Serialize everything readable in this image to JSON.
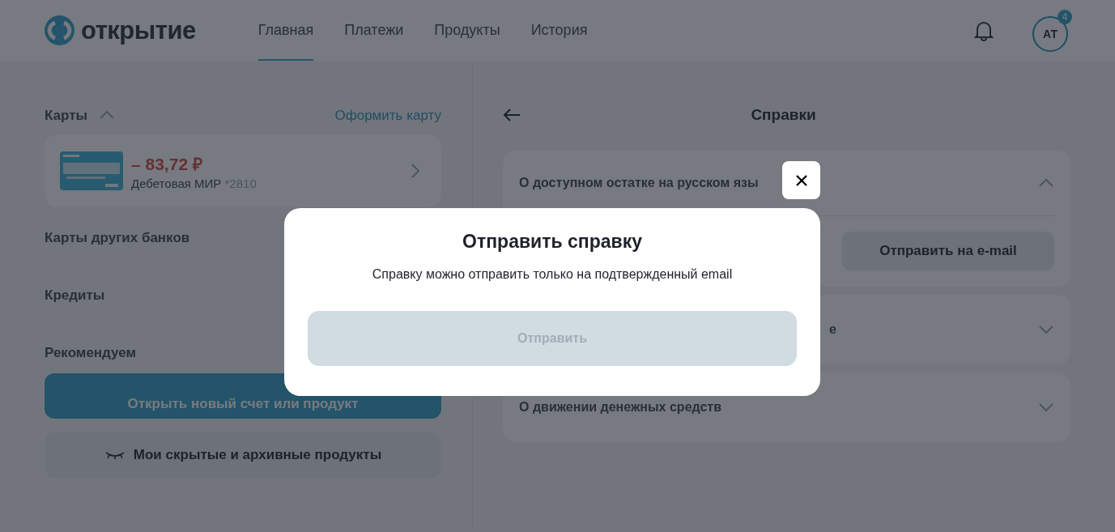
{
  "header": {
    "logo": "открытие",
    "nav": [
      {
        "label": "Главная",
        "selected": true
      },
      {
        "label": "Платежи",
        "selected": false
      },
      {
        "label": "Продукты",
        "selected": false
      },
      {
        "label": "История",
        "selected": false
      }
    ],
    "avatar": {
      "initials": "АТ",
      "badge": "4"
    }
  },
  "left": {
    "cards_title": "Карты",
    "cards_expanded": true,
    "order_card_link": "Оформить карту",
    "card": {
      "amount": "– 83,72 ₽",
      "name": "Дебетовая МИР",
      "number": "*2810"
    },
    "sections": [
      "Карты других банков",
      "Кредиты",
      "Рекомендуем"
    ],
    "open_button": "Открыть новый счет или продукт",
    "hidden_button": "Мои скрытые и архивные продукты"
  },
  "right": {
    "title": "Справки",
    "items": [
      {
        "title": "О доступном остатке на русском язы",
        "expanded": true,
        "covered": false,
        "action": "Отправить на e-mail"
      },
      {
        "title": "е",
        "expanded": false,
        "covered": true
      },
      {
        "title": "О движении денежных средств",
        "expanded": false,
        "covered": false
      }
    ]
  },
  "modal": {
    "title": "Отправить справку",
    "text": "Справку можно отправить только на подтвержденный email",
    "button": "Отправить",
    "button_disabled": true
  }
}
